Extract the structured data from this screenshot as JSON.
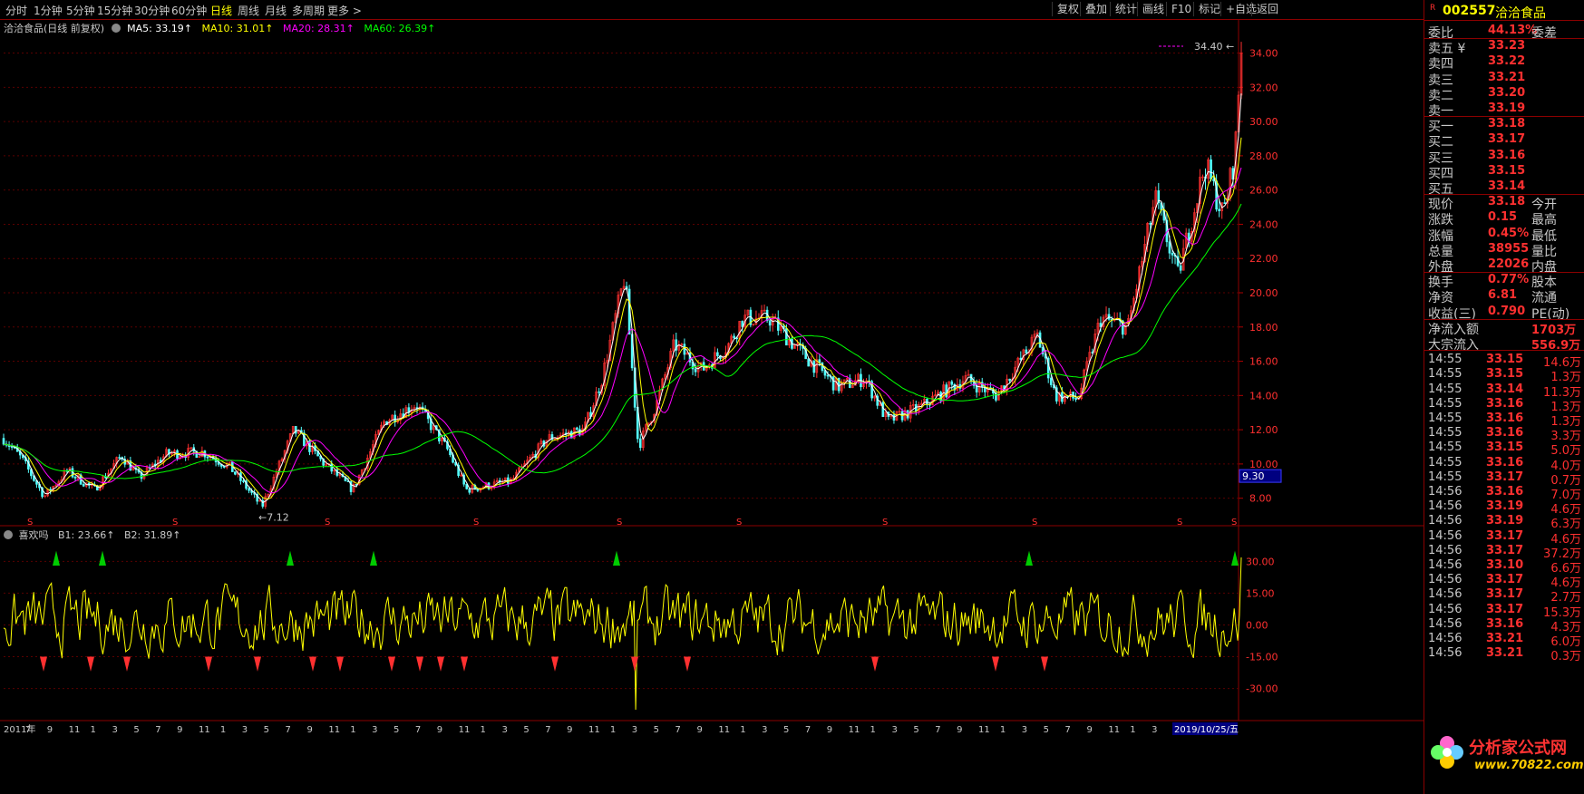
{
  "toolbar": {
    "periods": [
      "分时",
      "1分钟",
      "5分钟",
      "15分钟",
      "30分钟",
      "60分钟",
      "日线",
      "周线",
      "月线",
      "多周期",
      "更多 >"
    ],
    "active": "日线",
    "right_buttons": [
      "复权",
      "叠加",
      "统计",
      "画线",
      "F10",
      "标记",
      "+自选",
      "返回"
    ]
  },
  "header": {
    "title": "洽洽食品(日线 前复权)",
    "ma5": "MA5: 33.19↑",
    "ma10": "MA10: 31.01↑",
    "ma20": "MA20: 28.31↑",
    "ma60": "MA60: 26.39↑",
    "colors": {
      "ma5": "#ffffff",
      "ma10": "#ffff00",
      "ma20": "#ff00ff",
      "ma60": "#00ff00"
    }
  },
  "indicator_header": {
    "name": "喜欢吗",
    "b1": "B1: 23.66↑",
    "b2": "B2: 31.89↑"
  },
  "price_labels": {
    "high": "34.40",
    "low": "←7.12",
    "marker": "9.30"
  },
  "date_label": "2019/10/25/五",
  "right_panel": {
    "code": "002557",
    "name": "洽洽食品",
    "r_badge": "R",
    "weibi": {
      "label": "委比",
      "value": "44.13%",
      "right": "委差"
    },
    "sell": [
      {
        "label": "卖五 ¥",
        "price": "33.23"
      },
      {
        "label": "卖四",
        "price": "33.22"
      },
      {
        "label": "卖三",
        "price": "33.21"
      },
      {
        "label": "卖二",
        "price": "33.20"
      },
      {
        "label": "卖一",
        "price": "33.19"
      }
    ],
    "buy": [
      {
        "label": "买一",
        "price": "33.18"
      },
      {
        "label": "买二",
        "price": "33.17"
      },
      {
        "label": "买三",
        "price": "33.16"
      },
      {
        "label": "买四",
        "price": "33.15"
      },
      {
        "label": "买五",
        "price": "33.14"
      }
    ],
    "quote": [
      {
        "label": "现价",
        "value": "33.18",
        "right": "今开"
      },
      {
        "label": "涨跌",
        "value": "0.15",
        "right": "最高"
      },
      {
        "label": "涨幅",
        "value": "0.45%",
        "right": "最低"
      },
      {
        "label": "总量",
        "value": "38955",
        "right": "量比"
      },
      {
        "label": "外盘",
        "value": "22026",
        "right": "内盘"
      }
    ],
    "fund": [
      {
        "label": "换手",
        "value": "0.77%",
        "right": "股本"
      },
      {
        "label": "净资",
        "value": "6.81",
        "right": "流通"
      },
      {
        "label": "收益(三)",
        "value": "0.790",
        "right": "PE(动)"
      }
    ],
    "flow": [
      {
        "label": "净流入额",
        "value": "1703万"
      },
      {
        "label": "大宗流入",
        "value": "556.9万"
      }
    ],
    "ticks": [
      {
        "time": "14:55",
        "price": "33.15",
        "vol": "14.6万"
      },
      {
        "time": "14:55",
        "price": "33.15",
        "vol": "1.3万"
      },
      {
        "time": "14:55",
        "price": "33.14",
        "vol": "11.3万"
      },
      {
        "time": "14:55",
        "price": "33.16",
        "vol": "1.3万"
      },
      {
        "time": "14:55",
        "price": "33.16",
        "vol": "1.3万"
      },
      {
        "time": "14:55",
        "price": "33.16",
        "vol": "3.3万"
      },
      {
        "time": "14:55",
        "price": "33.15",
        "vol": "5.0万"
      },
      {
        "time": "14:55",
        "price": "33.16",
        "vol": "4.0万"
      },
      {
        "time": "14:55",
        "price": "33.17",
        "vol": "0.7万"
      },
      {
        "time": "14:56",
        "price": "33.16",
        "vol": "7.0万"
      },
      {
        "time": "14:56",
        "price": "33.19",
        "vol": "4.6万"
      },
      {
        "time": "14:56",
        "price": "33.19",
        "vol": "6.3万"
      },
      {
        "time": "14:56",
        "price": "33.17",
        "vol": "4.6万"
      },
      {
        "time": "14:56",
        "price": "33.17",
        "vol": "37.2万"
      },
      {
        "time": "14:56",
        "price": "33.10",
        "vol": "6.6万"
      },
      {
        "time": "14:56",
        "price": "33.17",
        "vol": "4.6万"
      },
      {
        "time": "14:56",
        "price": "33.17",
        "vol": "2.7万"
      },
      {
        "time": "14:56",
        "price": "33.17",
        "vol": "15.3万"
      },
      {
        "time": "14:56",
        "price": "33.16",
        "vol": "4.3万"
      },
      {
        "time": "14:56",
        "price": "33.21",
        "vol": "6.0万"
      },
      {
        "time": "14:56",
        "price": "33.21",
        "vol": "0.3万"
      }
    ]
  },
  "logo": {
    "text": "分析家公式网",
    "url": "www.70822.com"
  },
  "chart_data": [
    {
      "type": "candlestick",
      "title": "洽洽食品(日线 前复权)",
      "ylim": [
        6.5,
        35.3
      ],
      "yticks": [
        8,
        10,
        12,
        14,
        16,
        18,
        20,
        22,
        24,
        26,
        28,
        30,
        32,
        34
      ],
      "xticks": [
        "2011年",
        "7",
        "9",
        "11",
        "1",
        "3",
        "5",
        "7",
        "9",
        "11",
        "1",
        "3",
        "5",
        "7",
        "9",
        "11",
        "1",
        "3",
        "5",
        "7",
        "9",
        "11",
        "1",
        "3",
        "5",
        "7",
        "9",
        "11",
        "1",
        "3",
        "5",
        "7",
        "9",
        "11",
        "1",
        "3",
        "5",
        "7",
        "9",
        "11",
        "1",
        "3",
        "5",
        "7",
        "9",
        "11",
        "1",
        "3",
        "5",
        "7",
        "9",
        "11",
        "1",
        "3",
        "5",
        "2019/10/25/五"
      ],
      "close_approx": [
        [
          0,
          11.5
        ],
        [
          20,
          10.3
        ],
        [
          45,
          8.1
        ],
        [
          70,
          9.6
        ],
        [
          100,
          8.5
        ],
        [
          130,
          10.5
        ],
        [
          150,
          9.2
        ],
        [
          180,
          10.6
        ],
        [
          220,
          10.7
        ],
        [
          250,
          9.8
        ],
        [
          285,
          7.5
        ],
        [
          320,
          12.0
        ],
        [
          350,
          10.2
        ],
        [
          385,
          8.5
        ],
        [
          420,
          12.5
        ],
        [
          455,
          13.5
        ],
        [
          490,
          10.8
        ],
        [
          510,
          8.5
        ],
        [
          560,
          9.0
        ],
        [
          600,
          11.5
        ],
        [
          640,
          12.0
        ],
        [
          660,
          15.0
        ],
        [
          685,
          21.0
        ],
        [
          700,
          11.0
        ],
        [
          720,
          13.5
        ],
        [
          740,
          17.0
        ],
        [
          770,
          15.5
        ],
        [
          800,
          17.0
        ],
        [
          815,
          18.5
        ],
        [
          845,
          18.5
        ],
        [
          880,
          16.5
        ],
        [
          920,
          14.5
        ],
        [
          950,
          15.0
        ],
        [
          975,
          12.5
        ],
        [
          1010,
          13.3
        ],
        [
          1060,
          15.0
        ],
        [
          1095,
          14.0
        ],
        [
          1140,
          17.5
        ],
        [
          1160,
          14.0
        ],
        [
          1185,
          13.8
        ],
        [
          1210,
          18.5
        ],
        [
          1240,
          18.0
        ],
        [
          1270,
          25.5
        ],
        [
          1295,
          21.0
        ],
        [
          1325,
          27.5
        ],
        [
          1345,
          24.5
        ],
        [
          1358,
          28.0
        ],
        [
          1365,
          34.4
        ]
      ],
      "ma_series": [
        {
          "name": "MA5",
          "value": "33.19↑",
          "color": "#ffffff"
        },
        {
          "name": "MA10",
          "value": "31.01↑",
          "color": "#ffff00"
        },
        {
          "name": "MA20",
          "value": "28.31↑",
          "color": "#ff00ff"
        },
        {
          "name": "MA60",
          "value": "26.39↑",
          "color": "#00ff00"
        }
      ],
      "annotations": {
        "high": 34.4,
        "low": 7.12,
        "marker": 9.3
      }
    },
    {
      "type": "line",
      "title": "喜欢吗",
      "ylim": [
        -43,
        40
      ],
      "yticks": [
        30,
        15,
        0,
        -15,
        -30
      ],
      "series": [
        {
          "name": "B1",
          "value": "23.66↑",
          "color": "#ffff00"
        },
        {
          "name": "B2",
          "value": "31.89↑",
          "color": "#ffff00"
        }
      ]
    }
  ]
}
